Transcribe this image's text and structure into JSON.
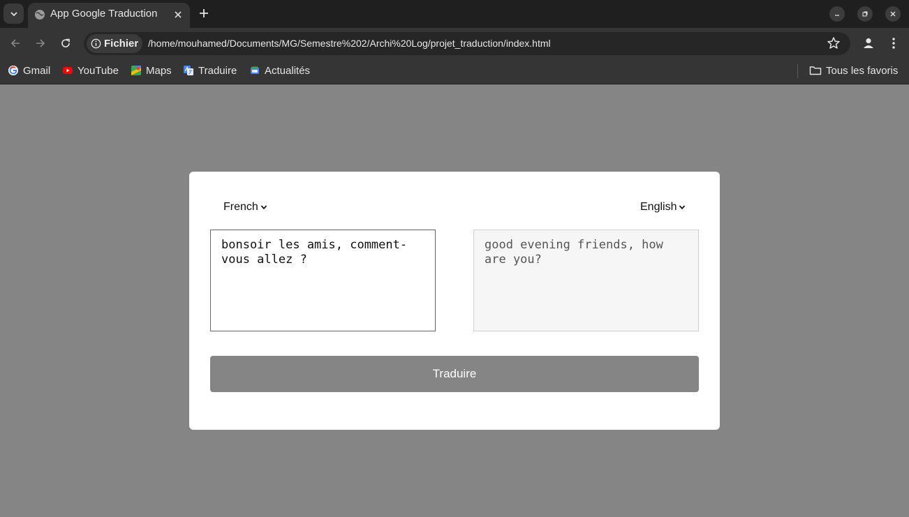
{
  "browser": {
    "tab": {
      "title": "App Google Traduction"
    },
    "address_bar": {
      "site_chip": "Fichier",
      "url": "/home/mouhamed/Documents/MG/Semestre%202/Archi%20Log/projet_traduction/index.html"
    },
    "bookmarks": [
      {
        "label": "Gmail",
        "icon": "gmail-icon"
      },
      {
        "label": "YouTube",
        "icon": "youtube-icon"
      },
      {
        "label": "Maps",
        "icon": "maps-icon"
      },
      {
        "label": "Traduire",
        "icon": "translate-icon"
      },
      {
        "label": "Actualités",
        "icon": "news-icon"
      }
    ],
    "all_bookmarks": "Tous les favoris"
  },
  "translator": {
    "source_language": "French",
    "target_language": "English",
    "source_text": "bonsoir les amis, comment-vous allez ?",
    "translated_text": "good evening friends, how are you?",
    "translate_button": "Traduire"
  },
  "colors": {
    "page_background": "#858585",
    "button_background": "#858585",
    "card_background": "#ffffff"
  }
}
